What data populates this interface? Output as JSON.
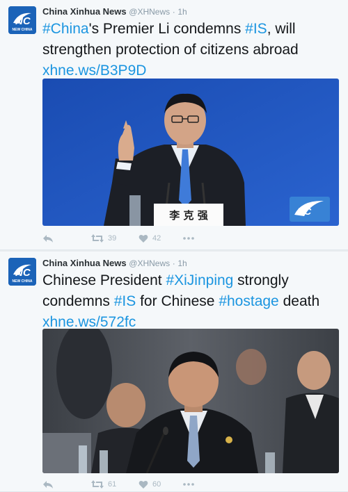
{
  "tweets": [
    {
      "author": "China Xinhua News",
      "handle": "@XHNews",
      "separator": "·",
      "time": "1h",
      "text_parts": [
        {
          "t": "#China",
          "k": "tag"
        },
        {
          "t": "'s Premier Li condemns ",
          "k": "plain"
        },
        {
          "t": "#IS",
          "k": "tag"
        },
        {
          "t": ", will strengthen protection of citizens abroad ",
          "k": "plain"
        },
        {
          "t": "xhne.ws/B3P9D",
          "k": "link"
        }
      ],
      "media": {
        "nameplate": "李 克 强",
        "watermark_logo": "NC",
        "background_color": "#1d4fb6"
      },
      "retweets": "39",
      "likes": "42"
    },
    {
      "author": "China Xinhua News",
      "handle": "@XHNews",
      "separator": "·",
      "time": "1h",
      "text_parts": [
        {
          "t": "Chinese President ",
          "k": "plain"
        },
        {
          "t": "#XiJinping",
          "k": "tag"
        },
        {
          "t": " strongly condemns ",
          "k": "plain"
        },
        {
          "t": "#IS",
          "k": "tag"
        },
        {
          "t": " for Chinese ",
          "k": "plain"
        },
        {
          "t": "#hostage",
          "k": "tag"
        },
        {
          "t": " death ",
          "k": "plain"
        },
        {
          "t": "xhne.ws/572fc",
          "k": "link"
        }
      ],
      "media": {
        "background_color": "#4a4f55"
      },
      "retweets": "61",
      "likes": "60"
    }
  ],
  "avatar": {
    "logo_text": "NC",
    "subtitle": "NEW CHINA",
    "color": "#1b63b8"
  },
  "colors": {
    "link": "#1b95e0",
    "action_icon": "#aab8c2"
  },
  "icons": {
    "reply": "reply-arrow-icon",
    "retweet": "retweet-icon",
    "like": "heart-icon",
    "more": "more-dots-icon"
  }
}
